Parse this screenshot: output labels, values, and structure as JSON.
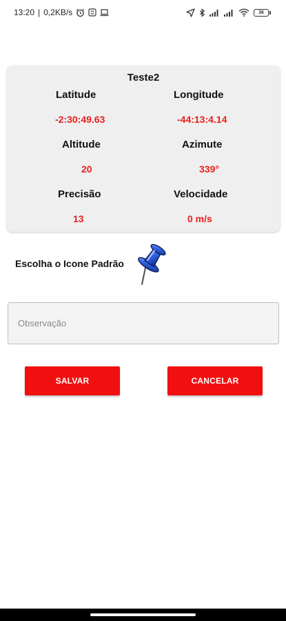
{
  "status_bar": {
    "time": "13:20",
    "network_speed": "0,2KB/s",
    "battery": "36",
    "icons": [
      "alarm-icon",
      "sync-icon",
      "laptop-icon",
      "location-arrow-icon",
      "bluetooth-icon",
      "signal-icon",
      "signal-icon",
      "wifi-icon",
      "battery-icon"
    ]
  },
  "card": {
    "title": "Teste2",
    "latitude_label": "Latitude",
    "latitude_value": "-2:30:49.63",
    "longitude_label": "Longitude",
    "longitude_value": "-44:13:4.14",
    "altitude_label": "Altitude",
    "altitude_value": "20",
    "azimute_label": "Azimute",
    "azimute_value": "339°",
    "precisao_label": "Precisão",
    "precisao_value": "13",
    "velocidade_label": "Velocidade",
    "velocidade_value": "0 m/s"
  },
  "icon_picker": {
    "label": "Escolha o Icone Padrão",
    "icon": "pushpin-icon"
  },
  "observation": {
    "placeholder": "Observação",
    "value": ""
  },
  "actions": {
    "save_label": "SALVAR",
    "cancel_label": "CANCELAR"
  },
  "colors": {
    "accent": "#f20f0f",
    "value_text": "#e8201c",
    "card_bg": "#efefef",
    "pin_blue": "#2f5fe0"
  }
}
